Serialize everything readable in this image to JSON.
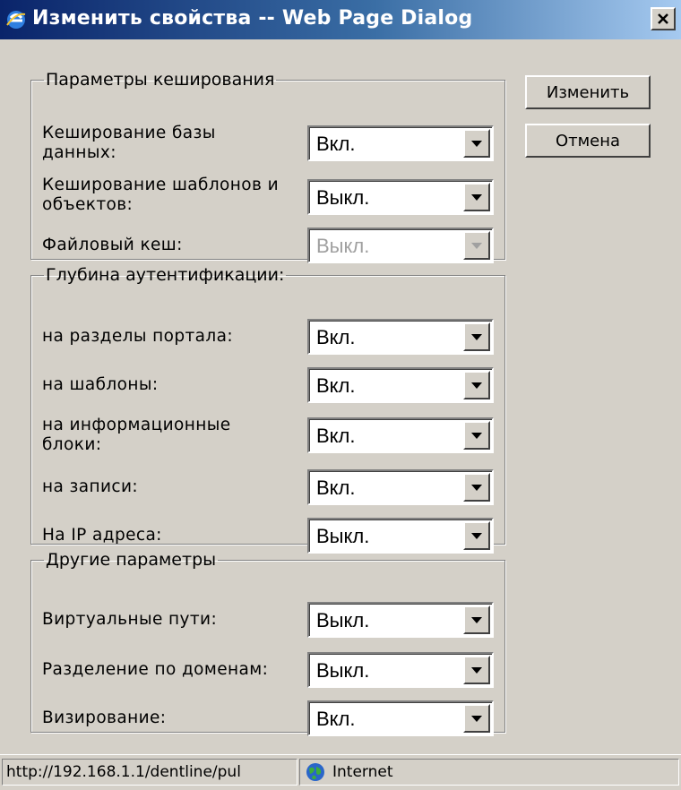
{
  "window": {
    "title": "Изменить свойства -- Web Page Dialog",
    "close_label": "×"
  },
  "groups": [
    {
      "legend": "Параметры кеширования",
      "rows": [
        {
          "label": "Кеширование базы данных:",
          "value": "Вкл.",
          "disabled": false
        },
        {
          "label": "Кеширование шаблонов и объектов:",
          "value": "Выкл.",
          "disabled": false
        },
        {
          "label": "Файловый кеш:",
          "value": "Выкл.",
          "disabled": true
        }
      ]
    },
    {
      "legend": "Глубина аутентификации:",
      "rows": [
        {
          "label": "на разделы портала:",
          "value": "Вкл.",
          "disabled": false
        },
        {
          "label": "на шаблоны:",
          "value": "Вкл.",
          "disabled": false
        },
        {
          "label": "на информационные блоки:",
          "value": "Вкл.",
          "disabled": false
        },
        {
          "label": "на записи:",
          "value": "Вкл.",
          "disabled": false
        },
        {
          "label": "На IP адреса:",
          "value": "Выкл.",
          "disabled": false
        }
      ]
    },
    {
      "legend": "Другие параметры",
      "rows": [
        {
          "label": "Виртуальные пути:",
          "value": "Выкл.",
          "disabled": false
        },
        {
          "label": "Разделение по доменам:",
          "value": "Выкл.",
          "disabled": false
        },
        {
          "label": "Визирование:",
          "value": "Вкл.",
          "disabled": false
        }
      ]
    }
  ],
  "buttons": {
    "apply": "Изменить",
    "cancel": "Отмена"
  },
  "statusbar": {
    "url": "http://192.168.1.1/dentline/pul",
    "zone": "Internet"
  }
}
